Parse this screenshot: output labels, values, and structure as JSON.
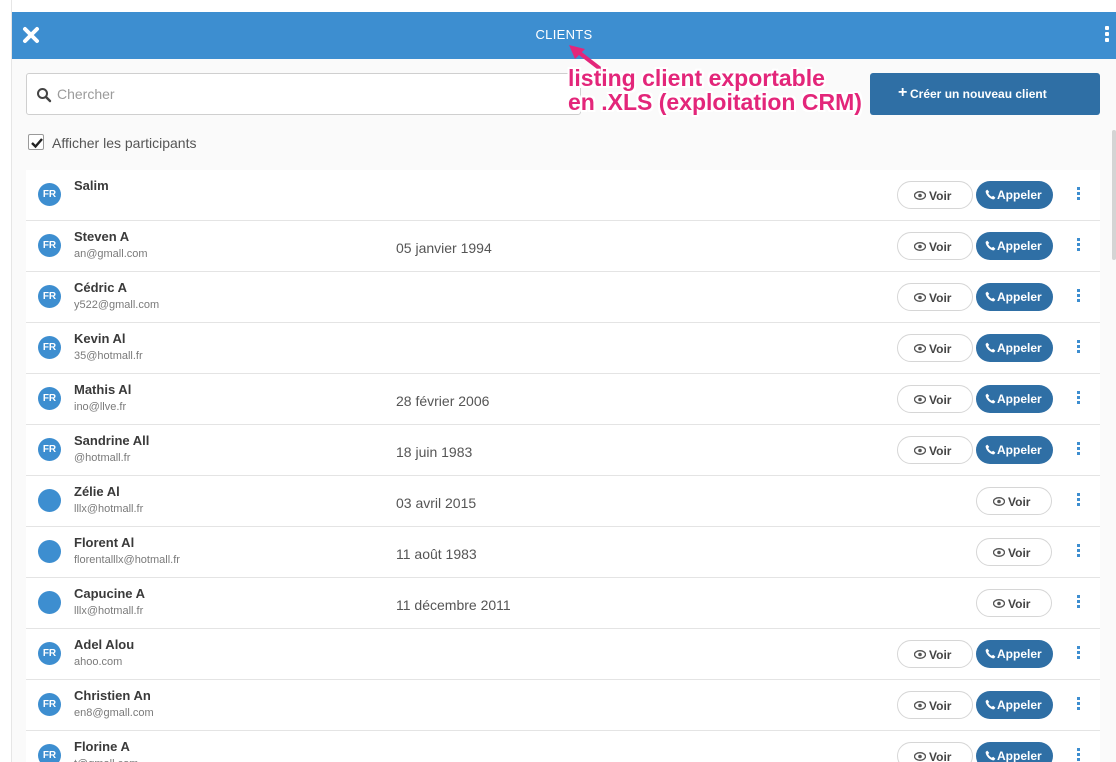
{
  "header": {
    "title": "CLIENTS"
  },
  "search": {
    "placeholder": "Chercher",
    "value": ""
  },
  "create_button": {
    "label": "Créer un nouveau client"
  },
  "annotation": {
    "line1": "listing client exportable",
    "line2": "en .XLS (exploitation CRM)"
  },
  "participants_checkbox": {
    "label": "Afficher les participants",
    "checked": true
  },
  "buttons": {
    "view": "Voir",
    "call": "Appeler"
  },
  "clients": [
    {
      "avatar": "FR",
      "name": "Salim",
      "email": "",
      "date": "",
      "can_call": true
    },
    {
      "avatar": "FR",
      "name": "Steven A",
      "email": "an@gmall.com",
      "date": "05 janvier 1994",
      "can_call": true
    },
    {
      "avatar": "FR",
      "name": "Cédric A",
      "email": "y522@gmall.com",
      "date": "",
      "can_call": true
    },
    {
      "avatar": "FR",
      "name": "Kevin Al",
      "email": "35@hotmall.fr",
      "date": "",
      "can_call": true
    },
    {
      "avatar": "FR",
      "name": "Mathis Al",
      "email": "ino@llve.fr",
      "date": "28 février 2006",
      "can_call": true
    },
    {
      "avatar": "FR",
      "name": "Sandrine All",
      "email": "@hotmall.fr",
      "date": "18 juin 1983",
      "can_call": true
    },
    {
      "avatar": "",
      "name": "Zélie Al",
      "email": "lllx@hotmall.fr",
      "date": "03 avril 2015",
      "can_call": false
    },
    {
      "avatar": "",
      "name": "Florent Al",
      "email": "florentalllx@hotmall.fr",
      "date": "11 août 1983",
      "can_call": false
    },
    {
      "avatar": "",
      "name": "Capucine A",
      "email": "lllx@hotmall.fr",
      "date": "11 décembre 2011",
      "can_call": false
    },
    {
      "avatar": "FR",
      "name": "Adel Alou",
      "email": "ahoo.com",
      "date": "",
      "can_call": true
    },
    {
      "avatar": "FR",
      "name": "Christien An",
      "email": "en8@gmall.com",
      "date": "",
      "can_call": true
    },
    {
      "avatar": "FR",
      "name": "Florine A",
      "email": "t@gmall.com",
      "date": "",
      "can_call": true
    }
  ],
  "colors": {
    "header": "#3d8ed0",
    "primary_button": "#2f6fa5",
    "annotation": "#e3267a"
  }
}
